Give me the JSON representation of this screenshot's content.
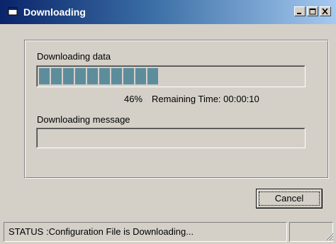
{
  "window": {
    "title": "Downloading"
  },
  "title_buttons": {
    "minimize": "minimize-icon",
    "maximize": "maximize-icon",
    "close": "close-icon"
  },
  "download": {
    "label": "Downloading data",
    "progress_percent": 46,
    "percent_text": "46%",
    "remaining_text": "Remaining Time: 00:00:10"
  },
  "message": {
    "label": "Downloading message",
    "value": ""
  },
  "buttons": {
    "cancel": "Cancel"
  },
  "status": {
    "text": "STATUS :Configuration File is Downloading...",
    "pane2": ""
  },
  "colors": {
    "progress_block": "#5d8d9c",
    "face": "#d4d0c8",
    "title_start": "#0a246a",
    "title_end": "#a6caf0"
  }
}
